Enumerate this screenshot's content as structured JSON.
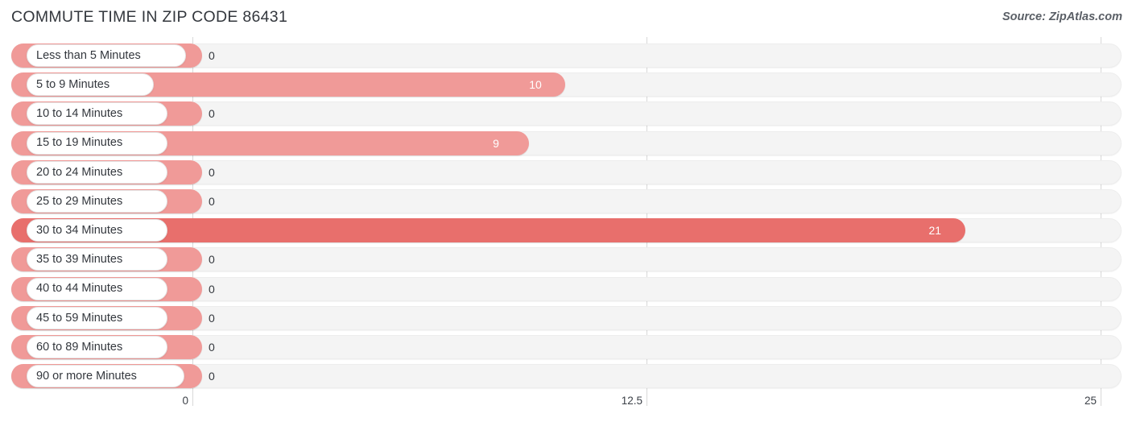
{
  "header": {
    "title": "COMMUTE TIME IN ZIP CODE 86431",
    "source": "Source: ZipAtlas.com"
  },
  "colors": {
    "bar_default": "#f09a98",
    "bar_max": "#e86f6c",
    "track": "#f4f4f4",
    "gridline": "#d8d8d8",
    "text": "#33373d"
  },
  "chart_data": {
    "type": "bar",
    "orientation": "horizontal",
    "title": "COMMUTE TIME IN ZIP CODE 86431",
    "xlabel": "",
    "ylabel": "",
    "xlim": [
      0,
      25
    ],
    "xticks": [
      0,
      12.5,
      25
    ],
    "xtick_labels": [
      "0",
      "12.5",
      "25"
    ],
    "grid": true,
    "legend": false,
    "categories": [
      "Less than 5 Minutes",
      "5 to 9 Minutes",
      "10 to 14 Minutes",
      "15 to 19 Minutes",
      "20 to 24 Minutes",
      "25 to 29 Minutes",
      "30 to 34 Minutes",
      "35 to 39 Minutes",
      "40 to 44 Minutes",
      "45 to 59 Minutes",
      "60 to 89 Minutes",
      "90 or more Minutes"
    ],
    "values": [
      0,
      10,
      0,
      9,
      0,
      0,
      21,
      0,
      0,
      0,
      0,
      0
    ],
    "value_labels": [
      "0",
      "10",
      "0",
      "9",
      "0",
      "0",
      "21",
      "0",
      "0",
      "0",
      "0",
      "0"
    ]
  },
  "rows": [
    {
      "label": "Less than 5 Minutes",
      "value": 0,
      "value_label": "0",
      "pill_width": 198,
      "highlight": false
    },
    {
      "label": "5 to 9 Minutes",
      "value": 10,
      "value_label": "10",
      "pill_width": 158,
      "highlight": false
    },
    {
      "label": "10 to 14 Minutes",
      "value": 0,
      "value_label": "0",
      "pill_width": 175,
      "highlight": false
    },
    {
      "label": "15 to 19 Minutes",
      "value": 9,
      "value_label": "9",
      "pill_width": 175,
      "highlight": false
    },
    {
      "label": "20 to 24 Minutes",
      "value": 0,
      "value_label": "0",
      "pill_width": 175,
      "highlight": false
    },
    {
      "label": "25 to 29 Minutes",
      "value": 0,
      "value_label": "0",
      "pill_width": 175,
      "highlight": false
    },
    {
      "label": "30 to 34 Minutes",
      "value": 21,
      "value_label": "21",
      "pill_width": 175,
      "highlight": true
    },
    {
      "label": "35 to 39 Minutes",
      "value": 0,
      "value_label": "0",
      "pill_width": 175,
      "highlight": false
    },
    {
      "label": "40 to 44 Minutes",
      "value": 0,
      "value_label": "0",
      "pill_width": 175,
      "highlight": false
    },
    {
      "label": "45 to 59 Minutes",
      "value": 0,
      "value_label": "0",
      "pill_width": 175,
      "highlight": false
    },
    {
      "label": "60 to 89 Minutes",
      "value": 0,
      "value_label": "0",
      "pill_width": 175,
      "highlight": false
    },
    {
      "label": "90 or more Minutes",
      "value": 0,
      "value_label": "0",
      "pill_width": 196,
      "highlight": false
    }
  ],
  "axis": {
    "ticks": [
      {
        "label": "0",
        "value": 0
      },
      {
        "label": "12.5",
        "value": 12.5
      },
      {
        "label": "25",
        "value": 25
      }
    ]
  }
}
